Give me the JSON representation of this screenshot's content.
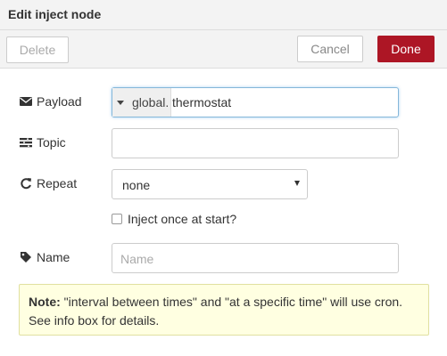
{
  "dialog": {
    "title": "Edit inject node",
    "delete_label": "Delete",
    "cancel_label": "Cancel",
    "done_label": "Done",
    "accent_color": "#ad1625"
  },
  "form": {
    "payload": {
      "label": "Payload",
      "icon": "envelope-icon",
      "type": "global.",
      "value": "thermostat"
    },
    "topic": {
      "label": "Topic",
      "icon": "tasks-icon",
      "value": ""
    },
    "repeat": {
      "label": "Repeat",
      "icon": "repeat-icon",
      "selected": "none"
    },
    "inject_once": {
      "label": "Inject once at start?",
      "checked": false
    },
    "name": {
      "label": "Name",
      "icon": "tag-icon",
      "placeholder": "Name",
      "value": ""
    }
  },
  "note": {
    "prefix": "Note:",
    "text": " \"interval between times\" and \"at a specific time\" will use cron. See info box for details."
  }
}
